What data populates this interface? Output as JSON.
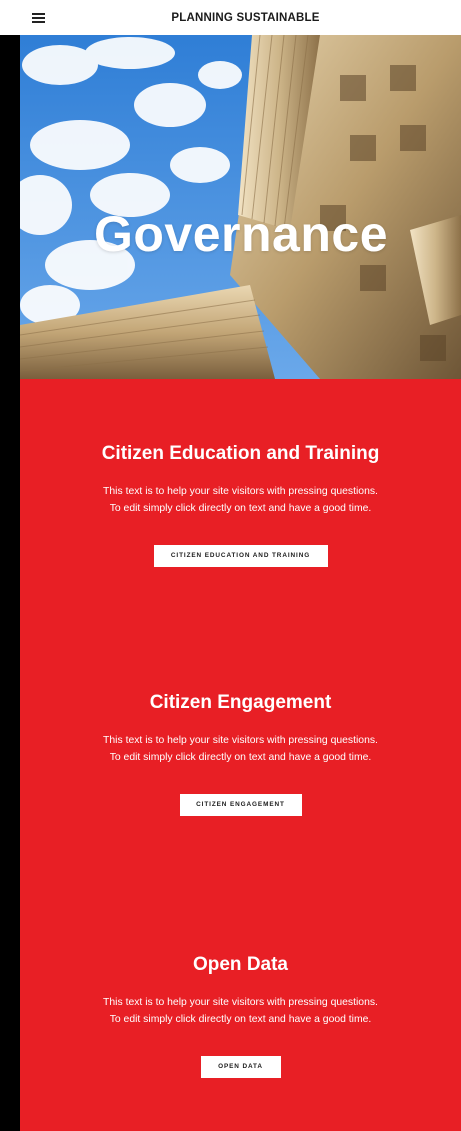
{
  "header": {
    "brand": "PLANNING SUSTAINABLE"
  },
  "hero": {
    "title": "Governance"
  },
  "sections": [
    {
      "title": "Citizen Education and Training",
      "text1": "This text is to help your site visitors with pressing questions.",
      "text2": "To edit simply click directly on text and have a good time.",
      "button": "CITIZEN EDUCATION AND TRAINING"
    },
    {
      "title": "Citizen Engagement",
      "text1": "This text is to help your site visitors with pressing questions.",
      "text2": "To edit simply click directly on text and have a good time.",
      "button": "CITIZEN ENGAGEMENT"
    },
    {
      "title": "Open Data",
      "text1": "This text is to help your site visitors with pressing questions.",
      "text2": "To edit simply click directly on text and have a good time.",
      "button": "OPEN DATA"
    }
  ],
  "colors": {
    "accent": "#e81f25",
    "header_bg": "#ffffff",
    "side_bar": "#000000"
  },
  "icons": {
    "menu": "hamburger-menu-icon"
  }
}
